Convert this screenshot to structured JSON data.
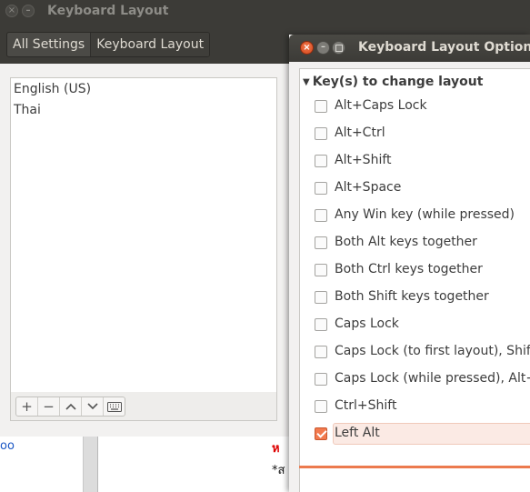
{
  "main_window": {
    "title": "Keyboard Layout",
    "breadcrumb": [
      "All Settings",
      "Keyboard Layout"
    ],
    "input_sources": [
      "English (US)",
      "Thai"
    ]
  },
  "dialog": {
    "title": "Keyboard Layout Options",
    "group_label": "Key(s) to change layout",
    "options": [
      {
        "label": "Alt+Caps Lock",
        "checked": false
      },
      {
        "label": "Alt+Ctrl",
        "checked": false
      },
      {
        "label": "Alt+Shift",
        "checked": false
      },
      {
        "label": "Alt+Space",
        "checked": false
      },
      {
        "label": "Any Win key (while pressed)",
        "checked": false
      },
      {
        "label": "Both Alt keys together",
        "checked": false
      },
      {
        "label": "Both Ctrl keys together",
        "checked": false
      },
      {
        "label": "Both Shift keys together",
        "checked": false
      },
      {
        "label": "Caps Lock",
        "checked": false
      },
      {
        "label": "Caps Lock (to first layout), Shift+",
        "checked": false
      },
      {
        "label": "Caps Lock (while pressed), Alt+C",
        "checked": false
      },
      {
        "label": "Ctrl+Shift",
        "checked": false
      },
      {
        "label": "Left Alt",
        "checked": true
      }
    ]
  },
  "background_document": {
    "left_fragment": "oo",
    "red_fragment": "ห",
    "black_fragment": "*ส"
  },
  "colors": {
    "accent": "#f27a4e",
    "titlebar": "#3c3b37",
    "window_bg": "#f2f1f0"
  }
}
